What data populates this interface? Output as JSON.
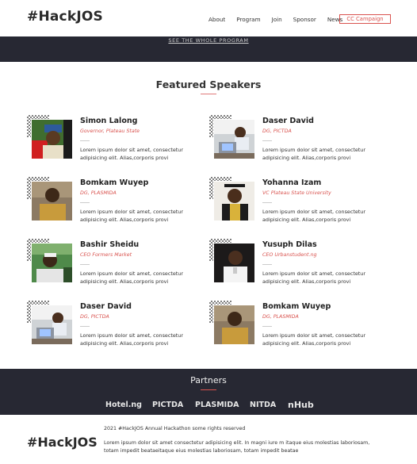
{
  "nav": {
    "logo": "#HackJOS",
    "links": [
      "About",
      "Program",
      "Join",
      "Sponsor",
      "News"
    ],
    "cta": "CC Campaign"
  },
  "hero": {
    "program_link": "SEE  THE  WHOLE  PROGRAM"
  },
  "speakers_section": {
    "title": "Featured Speakers",
    "speakers": [
      {
        "name": "Simon Lalong",
        "role": "Governor, Plateau State",
        "bio": "Lorem ipsum dolor sit amet, consectetur adipisicing elit. Alias,corporis provi",
        "photo": "photo-simon"
      },
      {
        "name": "Daser David",
        "role": "DG, PICTDA",
        "bio": "Lorem ipsum dolor sit amet, consectetur adipisicing elit. Alias,corporis provi",
        "photo": "photo-daser"
      },
      {
        "name": "Bomkam Wuyep",
        "role": "DG, PLASMIDA",
        "bio": "Lorem ipsum dolor sit amet, consectetur adipisicing elit. Alias,corporis provi",
        "photo": "photo-bomkam"
      },
      {
        "name": "Yohanna Izam",
        "role": "VC Plateau State University",
        "bio": "Lorem ipsum dolor sit amet, consectetur adipisicing elit. Alias,corporis provi",
        "photo": "photo-yohanna"
      },
      {
        "name": "Bashir Sheidu",
        "role": "CEO Formers Market",
        "bio": "Lorem ipsum dolor sit amet, consectetur adipisicing elit. Alias,corporis provi",
        "photo": "photo-bashir"
      },
      {
        "name": "Yusuph Dilas",
        "role": "CEO Urbanstudent.ng",
        "bio": "Lorem ipsum dolor sit amet, consectetur adipisicing elit. Alias,corporis provi",
        "photo": "photo-yusuph"
      },
      {
        "name": "Daser David",
        "role": "DG, PICTDA",
        "bio": "Lorem ipsum dolor sit amet, consectetur adipisicing elit. Alias,corporis provi",
        "photo": "photo-daser"
      },
      {
        "name": "Bomkam Wuyep",
        "role": "DG, PLASMIDA",
        "bio": "Lorem ipsum dolor sit amet, consectetur adipisicing elit. Alias,corporis provi",
        "photo": "photo-bomkam"
      }
    ]
  },
  "partners": {
    "title": "Partners",
    "items": [
      "Hotel.ng",
      "PICTDA",
      "PLASMIDA",
      "NITDA",
      "nHub"
    ]
  },
  "footer": {
    "logo": "#HackJOS",
    "copyright": "2021 #HackJOS Annual Hackathon some rights reserved",
    "text": "Lorem ipsum dolor sit amet consectetur adipisicing elit. In magni iure m itaque eius molestias laboriosam, totam impedit beataeitaque eius molestias laboriosam, totam impedit beatae"
  },
  "colors": {
    "accent": "#d9534f",
    "dark": "#272833"
  }
}
